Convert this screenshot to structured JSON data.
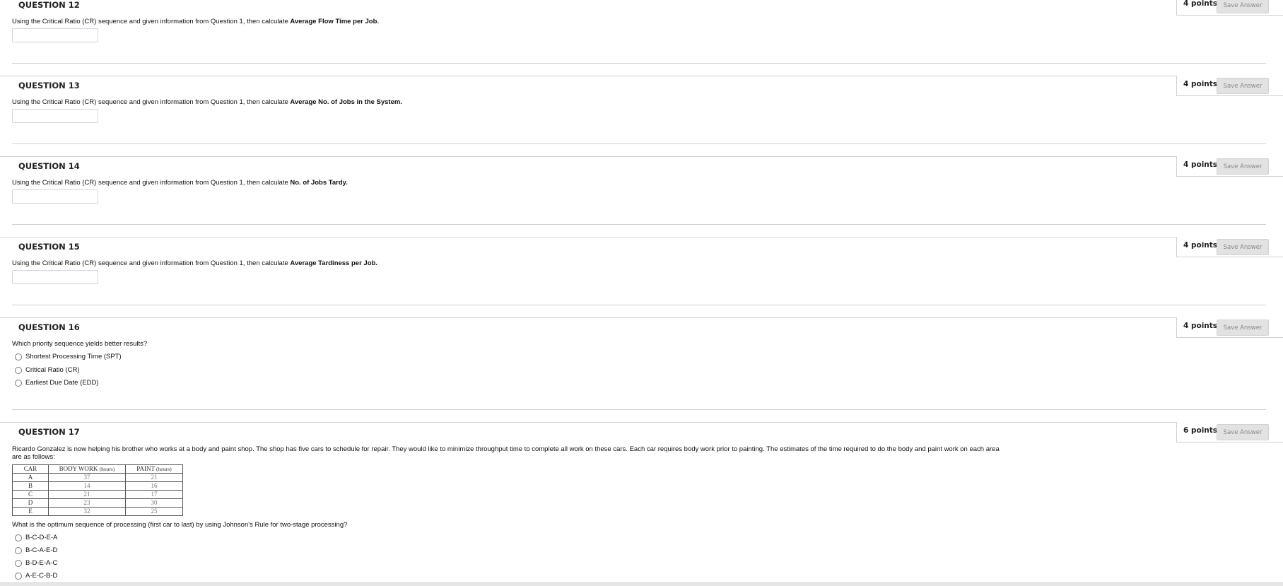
{
  "save_label": "Save Answer",
  "questions": [
    {
      "title": "QUESTION 12",
      "points": "4 points",
      "prompt": "Using the Critical Ratio (CR) sequence and given information from Question 1, then calculate ",
      "bold": "Average Flow Time per Job."
    },
    {
      "title": "QUESTION 13",
      "points": "4 points",
      "prompt": "Using the Critical Ratio (CR) sequence and given information from Question 1, then calculate ",
      "bold": "Average No. of Jobs in the System."
    },
    {
      "title": "QUESTION 14",
      "points": "4 points",
      "prompt": "Using the Critical Ratio (CR) sequence and given information from Question 1, then calculate ",
      "bold": "No. of Jobs Tardy."
    },
    {
      "title": "QUESTION 15",
      "points": "4 points",
      "prompt": "Using the Critical Ratio (CR) sequence and given information from Question 1, then calculate ",
      "bold": "Average Tardiness per Job."
    },
    {
      "title": "QUESTION 16",
      "points": "4 points",
      "prompt": "Which priority sequence yields better results?",
      "options": [
        "Shortest Processing Time (SPT)",
        "Critical Ratio (CR)",
        "Earliest Due Date (EDD)"
      ]
    },
    {
      "title": "QUESTION 17",
      "points": "6 points",
      "paragraph": "Ricardo Gonzalez is now helping his brother who works at a body and paint shop. The shop has five cars to schedule for repair. They would like to minimize throughput time to complete all work on these cars. Each car requires body work prior to painting. The estimates of the time required to do the body and paint work on each area are as follows:",
      "table": {
        "headers": [
          "CAR",
          "BODY WORK",
          "(hours)",
          "PAINT",
          "(hours)"
        ],
        "rows": [
          [
            "A",
            "37",
            "21"
          ],
          [
            "B",
            "14",
            "16"
          ],
          [
            "C",
            "21",
            "17"
          ],
          [
            "D",
            "23",
            "30"
          ],
          [
            "E",
            "32",
            "25"
          ]
        ]
      },
      "prompt": "What is the optimum sequence of processing (first car to last) by using Johnson's Rule for two-stage processing?",
      "options": [
        "B-C-D-E-A",
        "B-C-A-E-D",
        "B-D-E-A-C",
        "A-E-C-B-D"
      ]
    }
  ]
}
